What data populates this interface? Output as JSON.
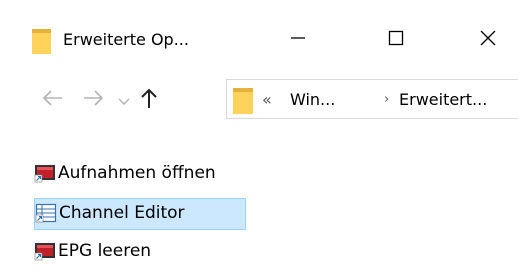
{
  "window": {
    "title": "Erweiterte Op...",
    "title_icon": "folder-icon",
    "buttons": {
      "minimize_icon": "minimize-icon",
      "maximize_icon": "maximize-icon",
      "close_icon": "close-icon"
    }
  },
  "navigation": {
    "back_icon": "arrow-left-icon",
    "forward_icon": "arrow-right-icon",
    "recent_icon": "chevron-down-icon",
    "up_icon": "arrow-up-icon",
    "address": {
      "overflow_chevron": "«",
      "segment_1": "Win...",
      "separator": "›",
      "segment_2": "Erweitert..."
    }
  },
  "items": [
    {
      "label": "Aufnahmen öffnen",
      "icon": "app-shortcut-icon"
    },
    {
      "label": "Channel Editor",
      "icon": "channel-editor-shortcut-icon",
      "selected": true
    },
    {
      "label": "EPG leeren",
      "icon": "app-shortcut-icon"
    }
  ],
  "colors": {
    "folder_yellow": "#ffd35b",
    "folder_dark": "#e6b13b",
    "selection_bg": "#cce8ff",
    "selection_border": "#99d1ff",
    "nav_disabled": "#b3b3b3"
  }
}
